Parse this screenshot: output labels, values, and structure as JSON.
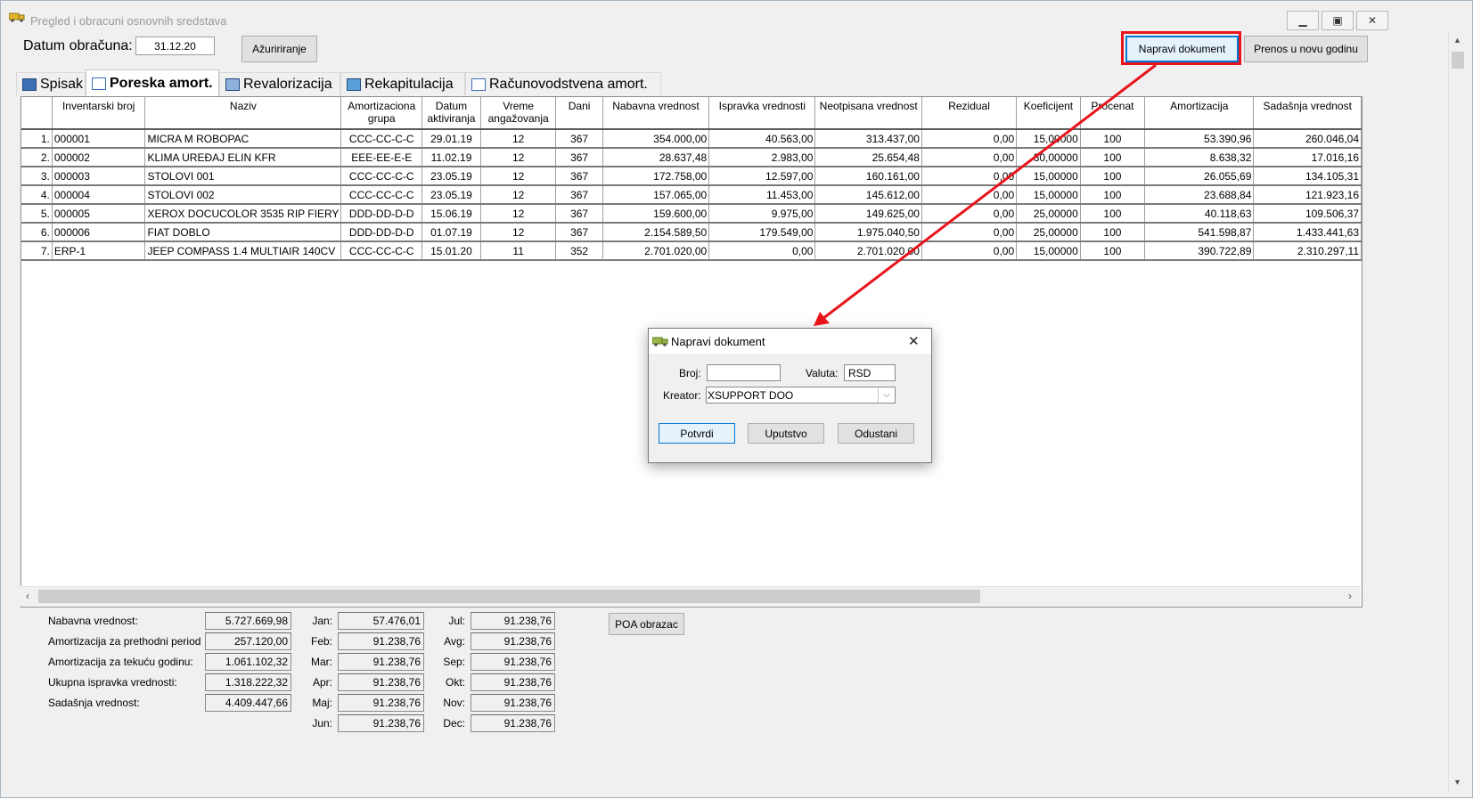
{
  "window": {
    "title": "Pregled i obracuni osnovnih sredstava",
    "minimize_icon": "minimize-icon",
    "maximize_icon": "maximize-icon",
    "close_icon": "close-icon"
  },
  "toolbar": {
    "date_label": "Datum obračuna:",
    "date_value": "31.12.20",
    "update_button": "Ažuririranje",
    "make_document_button": "Napravi dokument",
    "transfer_button": "Prenos u novu godinu"
  },
  "tabs": [
    {
      "label": "Spisak",
      "active": false
    },
    {
      "label": "Poreska amort.",
      "active": true
    },
    {
      "label": "Revalorizacija",
      "active": false
    },
    {
      "label": "Rekapitulacija",
      "active": false
    },
    {
      "label": "Računovodstvena amort.",
      "active": false
    }
  ],
  "table": {
    "columns": [
      "",
      "Inventarski broj",
      "Naziv",
      "Amortizaciona grupa",
      "Datum aktiviranja",
      "Vreme angažovanja",
      "Dani",
      "Nabavna vrednost",
      "Ispravka vrednosti",
      "Neotpisana vrednost",
      "Rezidual",
      "Koeficijent",
      "Procenat",
      "Amortizacija",
      "Sadašnja vrednost"
    ],
    "rows": [
      [
        "1.",
        "000001",
        "MICRA M ROBOPAC",
        "CCC-CC-C-C",
        "29.01.19",
        "12",
        "367",
        "354.000,00",
        "40.563,00",
        "313.437,00",
        "0,00",
        "15,00000",
        "100",
        "53.390,96",
        "260.046,04"
      ],
      [
        "2.",
        "000002",
        "KLIMA UREĐAJ ELIN KFR",
        "EEE-EE-E-E",
        "11.02.19",
        "12",
        "367",
        "28.637,48",
        "2.983,00",
        "25.654,48",
        "0,00",
        "30,00000",
        "100",
        "8.638,32",
        "17.016,16"
      ],
      [
        "3.",
        "000003",
        "STOLOVI 001",
        "CCC-CC-C-C",
        "23.05.19",
        "12",
        "367",
        "172.758,00",
        "12.597,00",
        "160.161,00",
        "0,00",
        "15,00000",
        "100",
        "26.055,69",
        "134.105,31"
      ],
      [
        "4.",
        "000004",
        "STOLOVI 002",
        "CCC-CC-C-C",
        "23.05.19",
        "12",
        "367",
        "157.065,00",
        "11.453,00",
        "145.612,00",
        "0,00",
        "15,00000",
        "100",
        "23.688,84",
        "121.923,16"
      ],
      [
        "5.",
        "000005",
        "XEROX DOCUCOLOR 3535 RIP FIERY",
        "DDD-DD-D-D",
        "15.06.19",
        "12",
        "367",
        "159.600,00",
        "9.975,00",
        "149.625,00",
        "0,00",
        "25,00000",
        "100",
        "40.118,63",
        "109.506,37"
      ],
      [
        "6.",
        "000006",
        "FIAT DOBLO",
        "DDD-DD-D-D",
        "01.07.19",
        "12",
        "367",
        "2.154.589,50",
        "179.549,00",
        "1.975.040,50",
        "0,00",
        "25,00000",
        "100",
        "541.598,87",
        "1.433.441,63"
      ],
      [
        "7.",
        "ERP-1",
        "JEEP COMPASS 1.4 MULTIAIR 140CV",
        "CCC-CC-C-C",
        "15.01.20",
        "11",
        "352",
        "2.701.020,00",
        "0,00",
        "2.701.020,00",
        "0,00",
        "15,00000",
        "100",
        "390.722,89",
        "2.310.297,11"
      ]
    ]
  },
  "summary": {
    "items": [
      {
        "label": "Nabavna vrednost:",
        "value": "5.727.669,98"
      },
      {
        "label": "Amortizacija za prethodni period",
        "value": "257.120,00"
      },
      {
        "label": "Amortizacija za tekuću godinu:",
        "value": "1.061.102,32"
      },
      {
        "label": "Ukupna ispravka vrednosti:",
        "value": "1.318.222,32"
      },
      {
        "label": "Sadašnja vrednost:",
        "value": "4.409.447,66"
      }
    ],
    "months_left": [
      {
        "label": "Jan:",
        "value": "57.476,01"
      },
      {
        "label": "Feb:",
        "value": "91.238,76"
      },
      {
        "label": "Mar:",
        "value": "91.238,76"
      },
      {
        "label": "Apr:",
        "value": "91.238,76"
      },
      {
        "label": "Maj:",
        "value": "91.238,76"
      },
      {
        "label": "Jun:",
        "value": "91.238,76"
      }
    ],
    "months_right": [
      {
        "label": "Jul:",
        "value": "91.238,76"
      },
      {
        "label": "Avg:",
        "value": "91.238,76"
      },
      {
        "label": "Sep:",
        "value": "91.238,76"
      },
      {
        "label": "Okt:",
        "value": "91.238,76"
      },
      {
        "label": "Nov:",
        "value": "91.238,76"
      },
      {
        "label": "Dec:",
        "value": "91.238,76"
      }
    ],
    "poa_button": "POA obrazac"
  },
  "dialog": {
    "title": "Napravi dokument",
    "broj_label": "Broj:",
    "broj_value": "",
    "valuta_label": "Valuta:",
    "valuta_value": "RSD",
    "kreator_label": "Kreator:",
    "kreator_value": "XSUPPORT DOO",
    "confirm_button": "Potvrdi",
    "help_button": "Uputstvo",
    "cancel_button": "Odustani"
  },
  "colors": {
    "annotation": "#e8141c",
    "focus": "#0078d7"
  }
}
